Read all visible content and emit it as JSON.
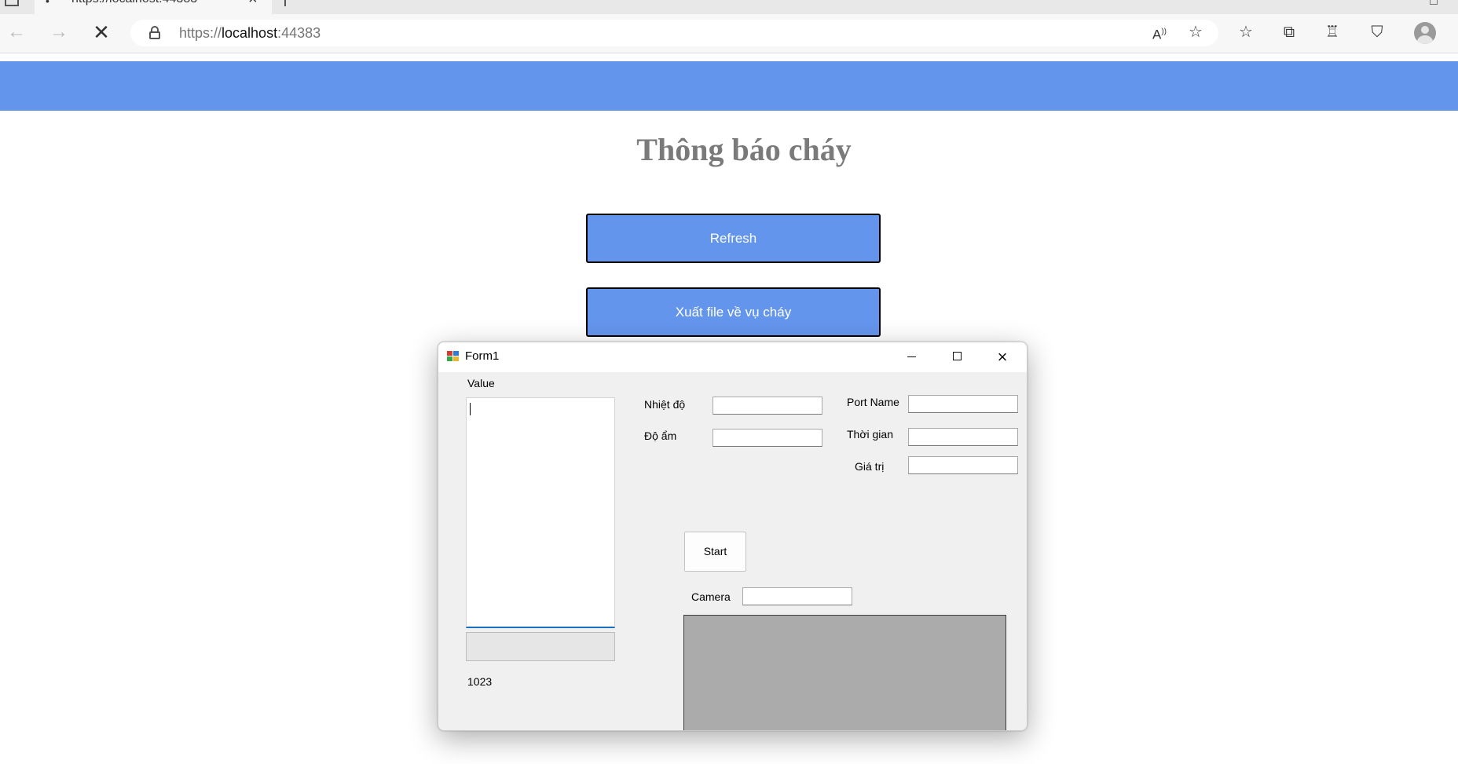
{
  "browser": {
    "tab_title": "https://localhost:44383",
    "url": {
      "scheme": "https://",
      "host": "localhost",
      "port": ":44383"
    },
    "icons": [
      "read-aloud-icon",
      "add-favorite-icon",
      "favorites-icon",
      "collections-icon",
      "extensions-icon",
      "browser-essentials-icon",
      "profile-icon"
    ]
  },
  "page": {
    "banner_color": "#6495ed",
    "title": "Thông báo cháy",
    "buttons": {
      "refresh": "Refresh",
      "export": "Xuất file về vụ cháy"
    }
  },
  "form": {
    "title": "Form1",
    "value_label": "Value",
    "value_text": "",
    "count_label": "1023",
    "fields": {
      "nhiet_do": {
        "label": "Nhiệt độ",
        "value": ""
      },
      "do_am": {
        "label": "Độ ẩm",
        "value": ""
      },
      "port_name": {
        "label": "Port Name",
        "value": ""
      },
      "thoi_gian": {
        "label": "Thời gian",
        "value": ""
      },
      "gia_tri": {
        "label": "Giá trị",
        "value": ""
      },
      "camera": {
        "label": "Camera",
        "value": ""
      }
    },
    "start_button": "Start",
    "progress": 0
  }
}
